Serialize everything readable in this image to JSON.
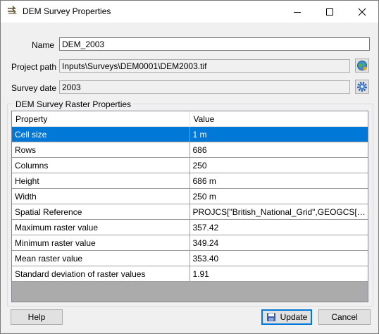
{
  "window": {
    "title": "DEM Survey Properties"
  },
  "fields": {
    "name": {
      "label": "Name",
      "value": "DEM_2003"
    },
    "project_path": {
      "label": "Project path",
      "value": "Inputs\\Surveys\\DEM0001\\DEM2003.tif"
    },
    "survey_date": {
      "label": "Survey date",
      "value": "2003"
    }
  },
  "group": {
    "title": "DEM Survey Raster Properties"
  },
  "grid": {
    "columns": [
      "Property",
      "Value"
    ],
    "rows": [
      {
        "property": "Cell size",
        "value": "1 m"
      },
      {
        "property": "Rows",
        "value": "686"
      },
      {
        "property": "Columns",
        "value": "250"
      },
      {
        "property": "Height",
        "value": "686 m"
      },
      {
        "property": "Width",
        "value": "250 m"
      },
      {
        "property": "Spatial Reference",
        "value": "PROJCS[\"British_National_Grid\",GEOGCS[\"GCS..."
      },
      {
        "property": "Maximum raster value",
        "value": "357.42"
      },
      {
        "property": "Minimum raster value",
        "value": "349.24"
      },
      {
        "property": "Mean raster value",
        "value": "353.40"
      },
      {
        "property": "Standard deviation of raster values",
        "value": "1.91"
      }
    ],
    "selected_row": "Cell size"
  },
  "buttons": {
    "help": "Help",
    "update": "Update",
    "cancel": "Cancel"
  },
  "icons": {
    "app": "arrows-app-icon",
    "browse_path": "globe-icon",
    "survey_date_settings": "gear-icon",
    "update": "save-disk-icon"
  },
  "colors": {
    "selection": "#0078d7",
    "grid_empty": "#ababab"
  }
}
